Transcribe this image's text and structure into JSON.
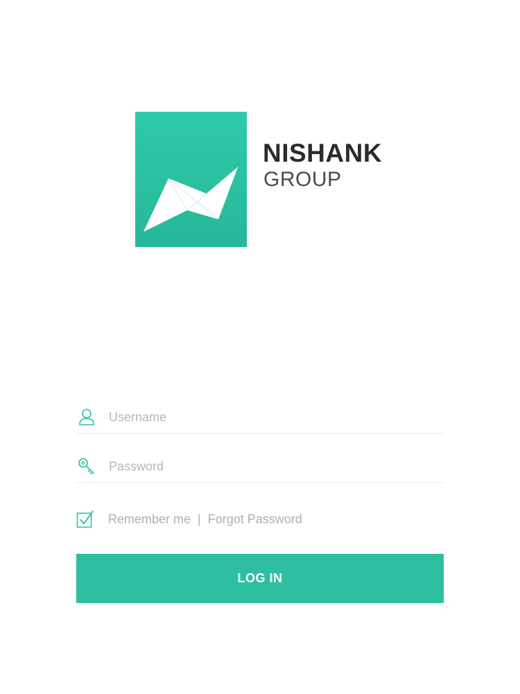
{
  "brand": {
    "name": "NISHANK",
    "subtitle": "GROUP",
    "accent_color": "#2dbfa0"
  },
  "form": {
    "username": {
      "placeholder": "Username",
      "value": "",
      "icon": "user-icon"
    },
    "password": {
      "placeholder": "Password",
      "value": "",
      "icon": "key-icon"
    },
    "remember": {
      "label": "Remember me",
      "checked": true,
      "icon": "checkbox-checked-icon"
    },
    "separator": "|",
    "forgot_label": "Forgot Password",
    "login_label": "LOG IN"
  }
}
